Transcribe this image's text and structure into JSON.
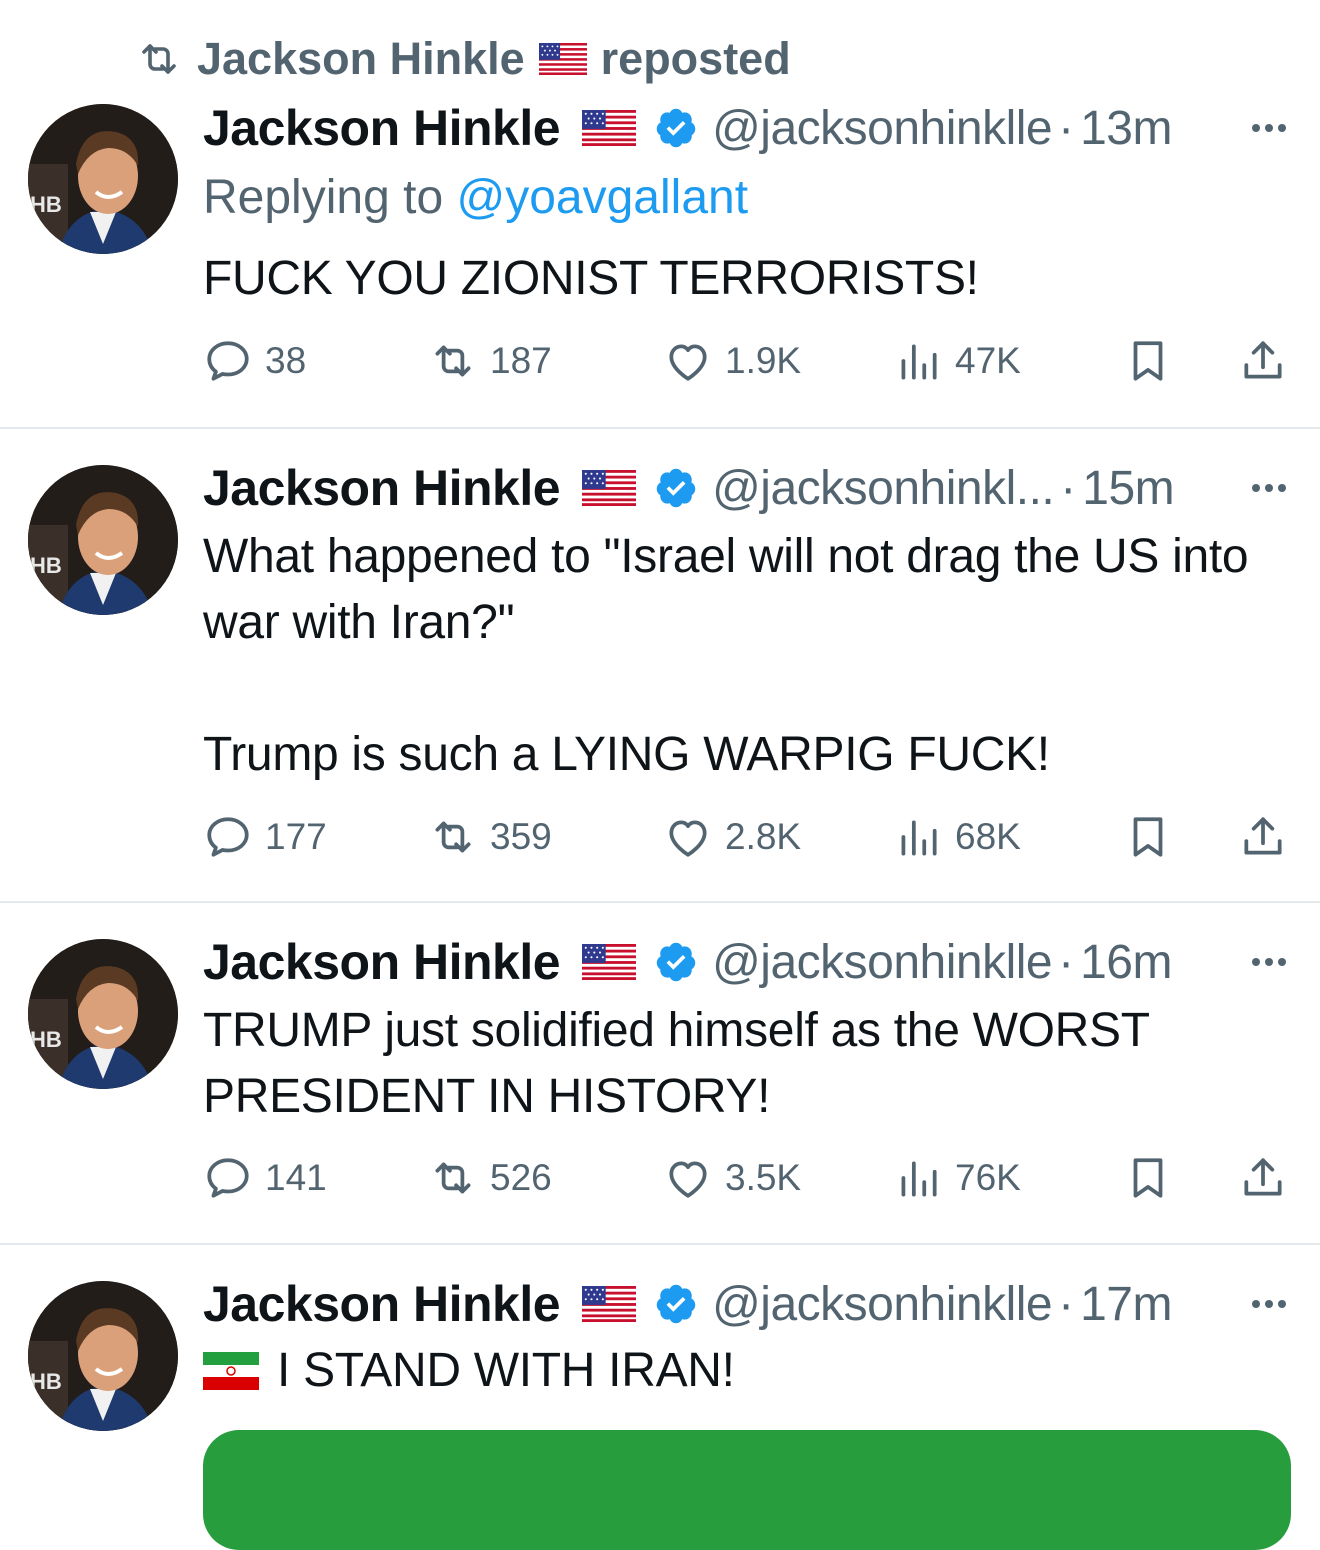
{
  "repost_banner": {
    "name": "Jackson Hinkle",
    "flag": "us-flag-icon",
    "suffix": "reposted"
  },
  "tweets": [
    {
      "name": "Jackson Hinkle",
      "handle": "@jacksonhinklle",
      "time": "13m",
      "replying_label": "Replying to ",
      "replying_to": "@yoavgallant",
      "text": "FUCK YOU ZIONIST TERRORISTS!",
      "stats": {
        "replies": "38",
        "reposts": "187",
        "likes": "1.9K",
        "views": "47K"
      }
    },
    {
      "name": "Jackson Hinkle",
      "handle": "@jacksonhinkl...",
      "time": "15m",
      "text": "What happened to \"Israel will not drag the US into war with Iran?\"\n\nTrump is such a LYING WARPIG FUCK!",
      "stats": {
        "replies": "177",
        "reposts": "359",
        "likes": "2.8K",
        "views": "68K"
      }
    },
    {
      "name": "Jackson Hinkle",
      "handle": "@jacksonhinklle",
      "time": "16m",
      "text": "TRUMP just solidified himself as the WORST PRESIDENT IN HISTORY!",
      "stats": {
        "replies": "141",
        "reposts": "526",
        "likes": "3.5K",
        "views": "76K"
      }
    },
    {
      "name": "Jackson Hinkle",
      "handle": "@jacksonhinklle",
      "time": "17m",
      "text_flag": "iran-flag-icon",
      "text": "I STAND WITH IRAN!",
      "media_color": "#279d3e"
    }
  ],
  "colors": {
    "muted": "#536471",
    "link": "#1d9bf0",
    "verified": "#1d9bf0",
    "text": "#0f1419"
  }
}
